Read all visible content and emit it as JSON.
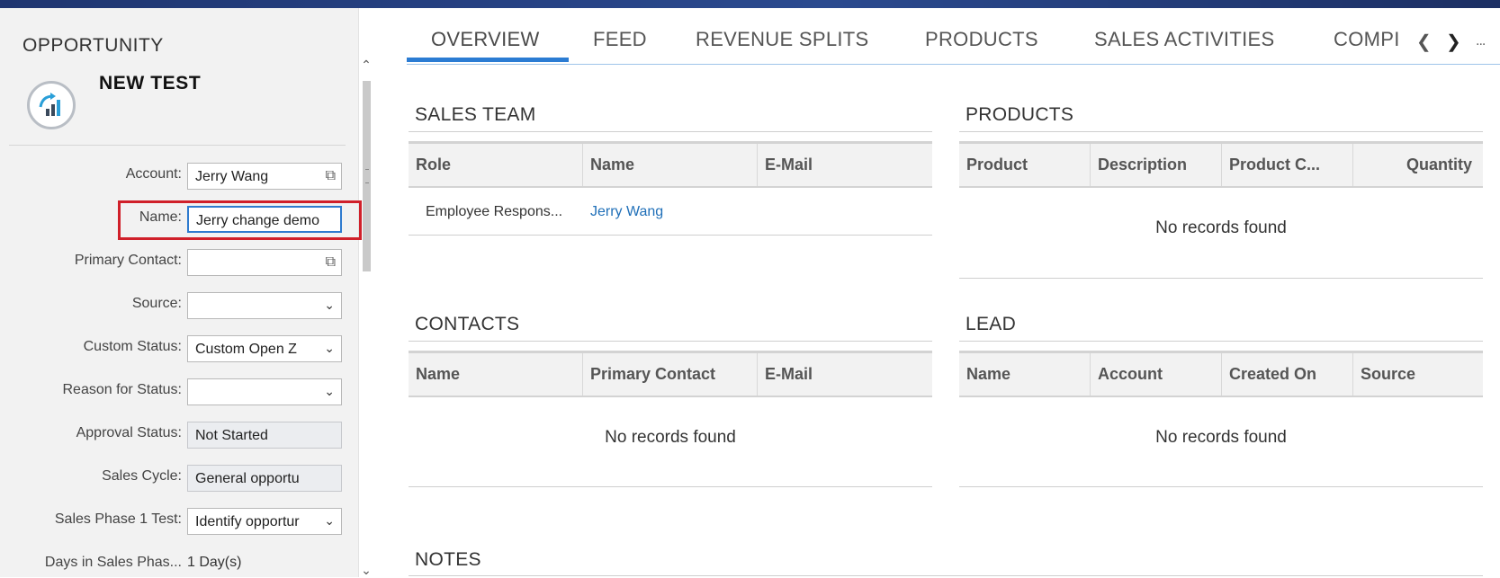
{
  "object_type": "OPPORTUNITY",
  "object_name": "NEW TEST",
  "fields": {
    "account": {
      "label": "Account:",
      "value": "Jerry Wang"
    },
    "name": {
      "label": "Name:",
      "value": "Jerry change demo"
    },
    "primary_contact": {
      "label": "Primary Contact:",
      "value": ""
    },
    "source": {
      "label": "Source:",
      "value": ""
    },
    "custom_status": {
      "label": "Custom Status:",
      "value": "Custom Open Z"
    },
    "reason_for_status": {
      "label": "Reason for Status:",
      "value": ""
    },
    "approval_status": {
      "label": "Approval Status:",
      "value": "Not Started"
    },
    "sales_cycle": {
      "label": "Sales Cycle:",
      "value": "General opportu"
    },
    "sales_phase": {
      "label": "Sales Phase 1 Test:",
      "value": "Identify opportur"
    },
    "days_in_phase": {
      "label": "Days in Sales Phas...",
      "value": "1 Day(s)"
    }
  },
  "tabs": [
    "OVERVIEW",
    "FEED",
    "REVENUE SPLITS",
    "PRODUCTS",
    "SALES ACTIVITIES",
    "COMPI"
  ],
  "tabs_more": "...",
  "sections": {
    "sales_team": {
      "title": "SALES TEAM",
      "columns": [
        "Role",
        "Name",
        "E-Mail"
      ],
      "row": {
        "role": "Employee Respons...",
        "name": "Jerry Wang",
        "email": ""
      }
    },
    "products": {
      "title": "PRODUCTS",
      "columns": [
        "Product",
        "Description",
        "Product C...",
        "Quantity"
      ],
      "empty": "No records found"
    },
    "contacts": {
      "title": "CONTACTS",
      "columns": [
        "Name",
        "Primary Contact",
        "E-Mail"
      ],
      "empty": "No records found"
    },
    "lead": {
      "title": "LEAD",
      "columns": [
        "Name",
        "Account",
        "Created On",
        "Source"
      ],
      "empty": "No records found"
    },
    "notes": {
      "title": "NOTES"
    }
  },
  "colors": {
    "accent": "#2b7cd3",
    "highlight": "#d0202a",
    "link": "#1f6fb8"
  }
}
